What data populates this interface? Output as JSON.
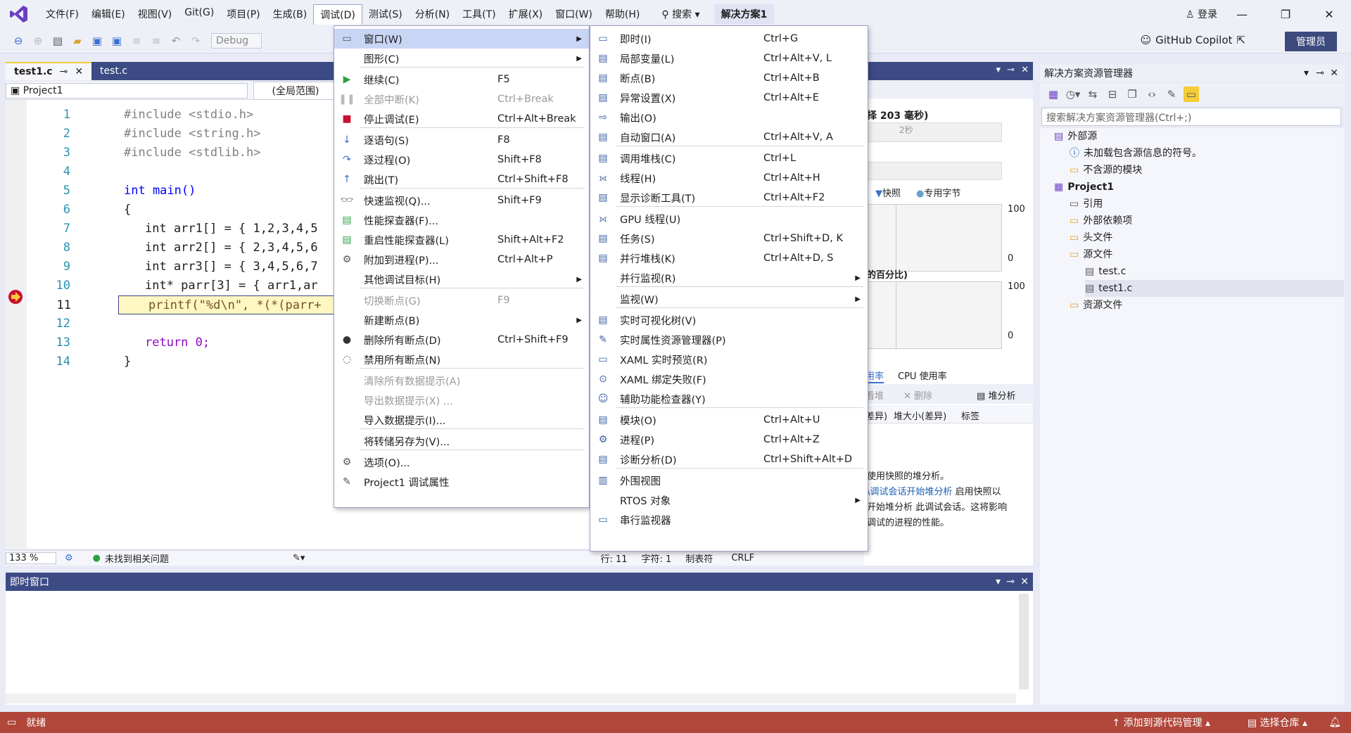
{
  "menubar": {
    "items": [
      "文件(F)",
      "编辑(E)",
      "视图(V)",
      "Git(G)",
      "项目(P)",
      "生成(B)",
      "调试(D)",
      "测试(S)",
      "分析(N)",
      "工具(T)",
      "扩展(X)",
      "窗口(W)",
      "帮助(H)"
    ],
    "search": "搜索",
    "solution": "解决方案1",
    "login": "登录"
  },
  "toolbar": {
    "config": "Debug",
    "copilot": "GitHub Copilot",
    "admin": "管理员"
  },
  "editor": {
    "tabs": [
      "test1.c",
      "test.c"
    ],
    "project_selector": "Project1",
    "scope_selector": "(全局范围)",
    "zoom": "133 %",
    "issues": "未找到相关问题",
    "line": "行: 11",
    "col": "字符: 1",
    "tab_mode": "制表符",
    "eol": "CRLF",
    "lines": [
      {
        "n": "1",
        "text": "#include <stdio.h>"
      },
      {
        "n": "2",
        "text": "#include <string.h>"
      },
      {
        "n": "3",
        "text": "#include <stdlib.h>"
      },
      {
        "n": "4",
        "text": ""
      },
      {
        "n": "5",
        "text": "int main()"
      },
      {
        "n": "6",
        "text": "{"
      },
      {
        "n": "7",
        "text": "int arr1[] = { 1,2,3,4,5"
      },
      {
        "n": "8",
        "text": "int arr2[] = { 2,3,4,5,6"
      },
      {
        "n": "9",
        "text": "int arr3[] = { 3,4,5,6,7"
      },
      {
        "n": "10",
        "text": "int* parr[3] = { arr1,ar"
      },
      {
        "n": "11",
        "text": "printf(\"%d\\n\", *(*(parr+"
      },
      {
        "n": "12",
        "text": ""
      },
      {
        "n": "13",
        "text": "return 0;"
      },
      {
        "n": "14",
        "text": "}"
      }
    ]
  },
  "diagnostics": {
    "duration": "择 203 毫秒)",
    "tick": "2秒",
    "legend_snapshot": "快照",
    "legend_private": "专用字节",
    "axis_top_1": "100",
    "axis_bottom_1": "0",
    "section2": "的百分比)",
    "axis_top_2": "100",
    "axis_bottom_2": "0",
    "tab_mem": "用率",
    "tab_cpu": "CPU 使用率",
    "heap": "看堆",
    "delete": "删除",
    "heap_analysis": "堆分析",
    "col_diff": "差异)",
    "col_heapsize": "堆大小(差异)",
    "col_tag": "标签",
    "msg1": "使用快照的堆分析。",
    "msg2_link": "\\调试会话开始堆分析",
    "msg2_rest": " 启用快照以",
    "msg3": "开始堆分析 此调试会话。这将影响",
    "msg4": "调试的进程的性能。"
  },
  "solution_explorer": {
    "title": "解决方案资源管理器",
    "search_placeholder": "搜索解决方案资源管理器(Ctrl+;)",
    "tree": [
      {
        "label": "外部源",
        "indent": 0
      },
      {
        "label": "未加载包含源信息的符号。",
        "indent": 1
      },
      {
        "label": "不含源的模块",
        "indent": 1
      },
      {
        "label": "Project1",
        "indent": 0,
        "bold": true
      },
      {
        "label": "引用",
        "indent": 1
      },
      {
        "label": "外部依赖项",
        "indent": 1
      },
      {
        "label": "头文件",
        "indent": 1
      },
      {
        "label": "源文件",
        "indent": 1
      },
      {
        "label": "test.c",
        "indent": 2
      },
      {
        "label": "test1.c",
        "indent": 2
      },
      {
        "label": "资源文件",
        "indent": 1
      }
    ]
  },
  "immediate": {
    "title": "即时窗口"
  },
  "statusbar": {
    "ready": "就绪",
    "add_source": "添加到源代码管理",
    "repo": "选择仓库"
  },
  "debug_menu": [
    {
      "label": "窗口(W)",
      "shortcut": "",
      "sub": true,
      "hl": true
    },
    {
      "label": "图形(C)",
      "shortcut": "",
      "sub": true
    },
    {
      "label": "继续(C)",
      "shortcut": "F5"
    },
    {
      "label": "全部中断(K)",
      "shortcut": "Ctrl+Break",
      "disabled": true
    },
    {
      "label": "停止调试(E)",
      "shortcut": "Ctrl+Alt+Break"
    },
    {
      "label": "逐语句(S)",
      "shortcut": "F8"
    },
    {
      "label": "逐过程(O)",
      "shortcut": "Shift+F8"
    },
    {
      "label": "跳出(T)",
      "shortcut": "Ctrl+Shift+F8"
    },
    {
      "label": "快速监视(Q)...",
      "shortcut": "Shift+F9"
    },
    {
      "label": "性能探查器(F)...",
      "shortcut": ""
    },
    {
      "label": "重启性能探查器(L)",
      "shortcut": "Shift+Alt+F2"
    },
    {
      "label": "附加到进程(P)...",
      "shortcut": "Ctrl+Alt+P"
    },
    {
      "label": "其他调试目标(H)",
      "shortcut": "",
      "sub": true
    },
    {
      "label": "切换断点(G)",
      "shortcut": "F9",
      "disabled": true
    },
    {
      "label": "新建断点(B)",
      "shortcut": "",
      "sub": true
    },
    {
      "label": "删除所有断点(D)",
      "shortcut": "Ctrl+Shift+F9"
    },
    {
      "label": "禁用所有断点(N)",
      "shortcut": ""
    },
    {
      "label": "清除所有数据提示(A)",
      "shortcut": "",
      "disabled": true
    },
    {
      "label": "导出数据提示(X) ...",
      "shortcut": "",
      "disabled": true
    },
    {
      "label": "导入数据提示(I)...",
      "shortcut": ""
    },
    {
      "label": "将转储另存为(V)...",
      "shortcut": ""
    },
    {
      "label": "选项(O)...",
      "shortcut": ""
    },
    {
      "label": "Project1 调试属性",
      "shortcut": ""
    }
  ],
  "window_submenu": [
    {
      "label": "即时(I)",
      "shortcut": "Ctrl+G"
    },
    {
      "label": "局部变量(L)",
      "shortcut": "Ctrl+Alt+V, L"
    },
    {
      "label": "断点(B)",
      "shortcut": "Ctrl+Alt+B"
    },
    {
      "label": "异常设置(X)",
      "shortcut": "Ctrl+Alt+E"
    },
    {
      "label": "输出(O)",
      "shortcut": ""
    },
    {
      "label": "自动窗口(A)",
      "shortcut": "Ctrl+Alt+V, A"
    },
    {
      "label": "调用堆栈(C)",
      "shortcut": "Ctrl+L"
    },
    {
      "label": "线程(H)",
      "shortcut": "Ctrl+Alt+H"
    },
    {
      "label": "显示诊断工具(T)",
      "shortcut": "Ctrl+Alt+F2"
    },
    {
      "label": "GPU 线程(U)",
      "shortcut": ""
    },
    {
      "label": "任务(S)",
      "shortcut": "Ctrl+Shift+D, K"
    },
    {
      "label": "并行堆栈(K)",
      "shortcut": "Ctrl+Alt+D, S"
    },
    {
      "label": "并行监视(R)",
      "shortcut": "",
      "sub": true
    },
    {
      "label": "监视(W)",
      "shortcut": "",
      "sub": true
    },
    {
      "label": "实时可视化树(V)",
      "shortcut": ""
    },
    {
      "label": "实时属性资源管理器(P)",
      "shortcut": ""
    },
    {
      "label": "XAML 实时预览(R)",
      "shortcut": ""
    },
    {
      "label": "XAML 绑定失败(F)",
      "shortcut": ""
    },
    {
      "label": "辅助功能检查器(Y)",
      "shortcut": ""
    },
    {
      "label": "模块(O)",
      "shortcut": "Ctrl+Alt+U"
    },
    {
      "label": "进程(P)",
      "shortcut": "Ctrl+Alt+Z"
    },
    {
      "label": "诊断分析(D)",
      "shortcut": "Ctrl+Shift+Alt+D"
    },
    {
      "label": "外围视图",
      "shortcut": ""
    },
    {
      "label": "RTOS 对象",
      "shortcut": "",
      "sub": true
    },
    {
      "label": "串行监视器",
      "shortcut": ""
    }
  ],
  "colors": {
    "accent": "#3c4b84",
    "status": "#b0473a",
    "highlight": "#c9d5f5",
    "bp": "#c8102e"
  }
}
